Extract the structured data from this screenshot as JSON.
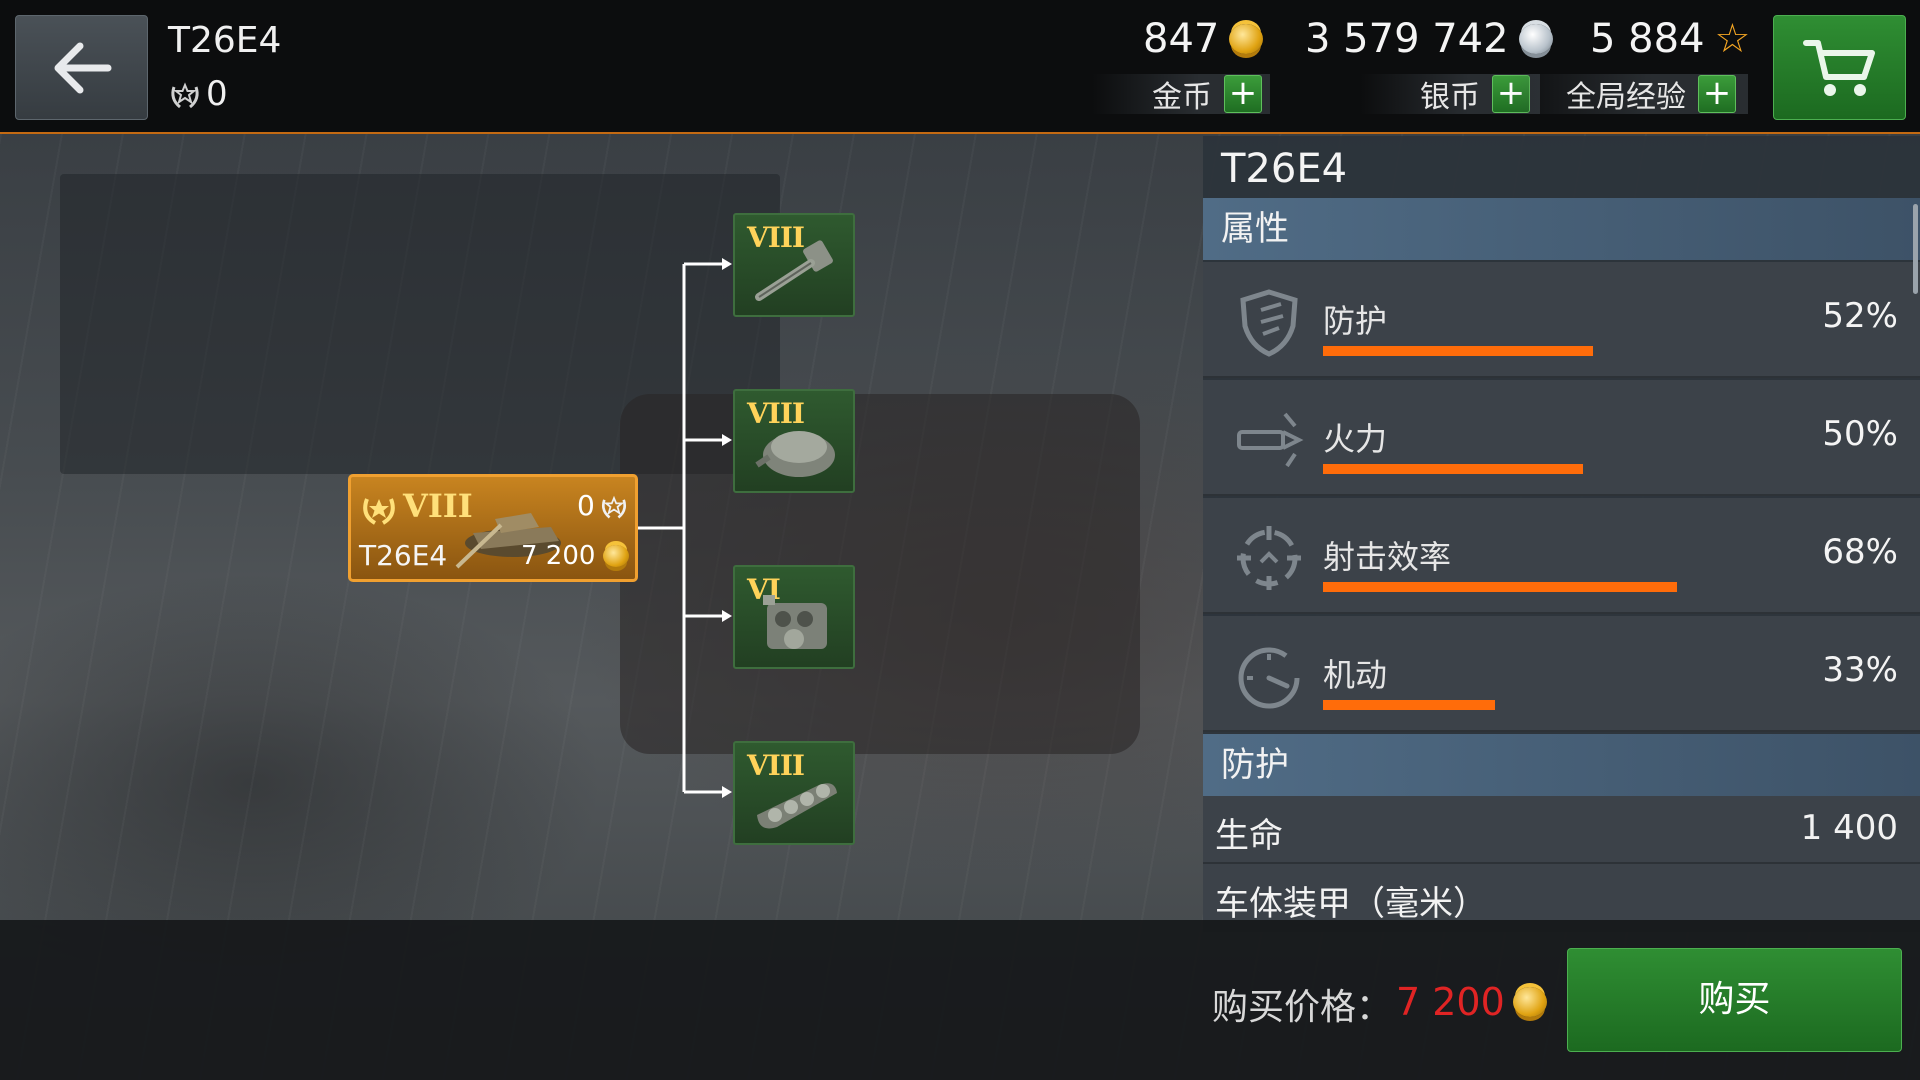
{
  "header": {
    "title": "T26E4",
    "crew_xp": "0",
    "gold": {
      "amount": "847",
      "label": "金币"
    },
    "silver": {
      "amount": "3 579 742",
      "label": "银币"
    },
    "global_xp": {
      "amount": "5 884",
      "label": "全局经验"
    },
    "plus_symbol": "+"
  },
  "tree": {
    "tank": {
      "tier": "VIII",
      "name": "T26E4",
      "xp": "0",
      "price": "7 200"
    },
    "modules": [
      {
        "tier": "VIII",
        "type": "gun-icon"
      },
      {
        "tier": "VIII",
        "type": "turret-icon"
      },
      {
        "tier": "VI",
        "type": "engine-icon"
      },
      {
        "tier": "VIII",
        "type": "tracks-icon"
      }
    ]
  },
  "panel": {
    "title": "T26E4",
    "attributes_header": "属性",
    "stats": [
      {
        "label": "防护",
        "value": "52%",
        "fraction": 0.52,
        "icon": "shield-icon"
      },
      {
        "label": "火力",
        "value": "50%",
        "fraction": 0.5,
        "icon": "shell-icon"
      },
      {
        "label": "射击效率",
        "value": "68%",
        "fraction": 0.68,
        "icon": "crosshair-icon"
      },
      {
        "label": "机动",
        "value": "33%",
        "fraction": 0.33,
        "icon": "speedometer-icon"
      }
    ],
    "protection_header": "防护",
    "hp": {
      "label": "生命",
      "value": "1 400"
    },
    "hull_armor": {
      "label": "车体装甲（毫米）"
    }
  },
  "purchase": {
    "label": "购买价格：",
    "price": "7 200",
    "buy_label": "购买"
  },
  "colors": {
    "accent_orange": "#ff6c0a",
    "button_green": "#2f8e33",
    "price_red": "#e02424",
    "tier_gold": "#ffd35a"
  }
}
